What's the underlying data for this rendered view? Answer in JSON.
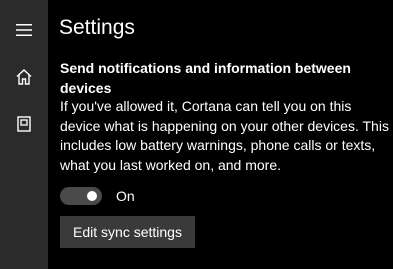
{
  "colors": {
    "background": "#000000",
    "rail": "#2b2b2b",
    "text": "#ffffff",
    "toggle_track": "#4a4a4a",
    "button_bg": "#3a3a3a"
  },
  "nav": {
    "items": [
      {
        "icon": "hamburger-menu-icon"
      },
      {
        "icon": "home-icon"
      },
      {
        "icon": "notebook-icon"
      }
    ]
  },
  "page": {
    "title": "Settings"
  },
  "section": {
    "heading": "Send notifications and information between devices",
    "description": "If you've allowed it, Cortana can tell you on this device what is happening on your other devices. This includes low battery warnings, phone calls or texts, what you last worked on, and more."
  },
  "toggle": {
    "state": true,
    "label": "On"
  },
  "actions": {
    "edit_sync_label": "Edit sync settings"
  }
}
